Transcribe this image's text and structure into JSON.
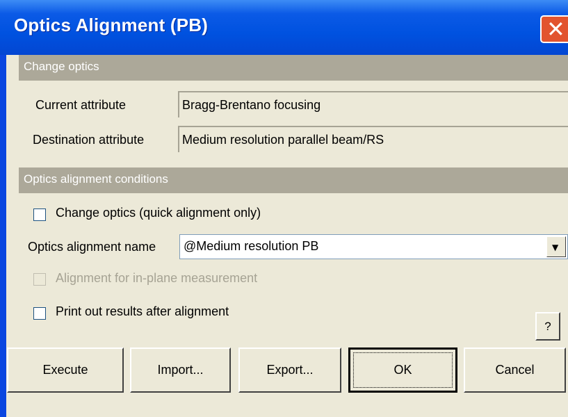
{
  "window": {
    "title": "Optics Alignment (PB)",
    "close_glyph": "✕"
  },
  "change_optics": {
    "header": "Change optics",
    "current_label": "Current attribute",
    "current_value": "Bragg-Brentano focusing",
    "destination_label": "Destination attribute",
    "destination_value": "Medium resolution parallel beam/RS"
  },
  "conditions": {
    "header": "Optics alignment conditions",
    "quick_alignment_label": "Change optics (quick alignment only)",
    "quick_alignment_checked": false,
    "alignment_name_label": "Optics alignment name",
    "alignment_name_value": "@Medium resolution PB",
    "in_plane_label": "Alignment for in-plane measurement",
    "in_plane_enabled": false,
    "print_results_label": "Print out results after alignment",
    "print_results_checked": false
  },
  "buttons": {
    "help": "?",
    "execute": "Execute",
    "import": "Import...",
    "export": "Export...",
    "ok": "OK",
    "cancel": "Cancel"
  },
  "colors": {
    "titlebar": "#0052e0",
    "section_header": "#aca899",
    "dialog_bg": "#ece9d8",
    "close_button": "#e2542f"
  },
  "icons": {
    "dropdown": "chevron-down-icon",
    "close": "close-icon"
  }
}
